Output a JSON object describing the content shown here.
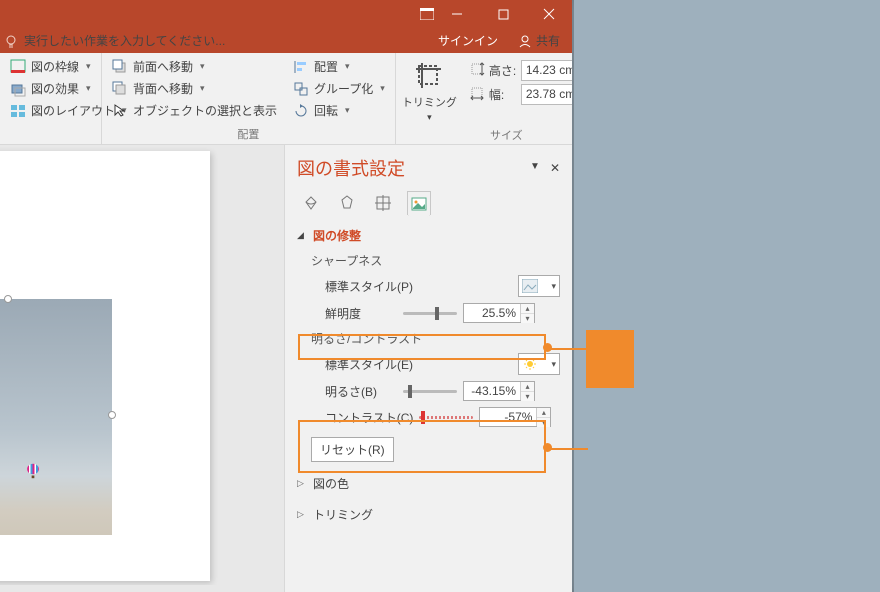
{
  "window": {
    "tell_me_placeholder": "実行したい作業を入力してください...",
    "signin": "サインイン",
    "share": "共有"
  },
  "ribbon": {
    "group_styles": {
      "border": "図の枠線",
      "effects": "図の効果",
      "layout": "図のレイアウト"
    },
    "group_arrange": {
      "label": "配置",
      "bring_forward": "前面へ移動",
      "send_backward": "背面へ移動",
      "selection_pane": "オブジェクトの選択と表示",
      "align": "配置",
      "group": "グループ化",
      "rotate": "回転"
    },
    "group_size": {
      "label": "サイズ",
      "crop": "トリミング",
      "height_label": "高さ:",
      "height_value": "14.23 cm",
      "width_label": "幅:",
      "width_value": "23.78 cm"
    }
  },
  "pane": {
    "title": "図の書式設定",
    "section_corrections": "図の修整",
    "sharpness_header": "シャープネス",
    "presets_p": "標準スタイル(P)",
    "sharpness_label": "鮮明度",
    "sharpness_value": "25.5%",
    "brightness_contrast_header": "明るさ/コントラスト",
    "presets_e": "標準スタイル(E)",
    "brightness_label": "明るさ(B)",
    "brightness_value": "-43.15%",
    "contrast_label": "コントラスト(C)",
    "contrast_value": "-57%",
    "reset": "リセット(R)",
    "section_color": "図の色",
    "section_crop": "トリミング"
  }
}
